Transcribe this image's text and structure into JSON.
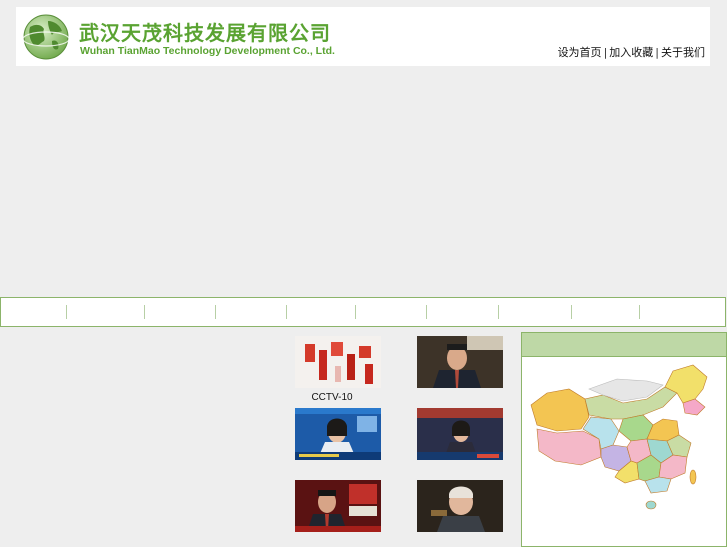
{
  "header": {
    "company_name_cn": "武汉天茂科技发展有限公司",
    "company_name_en": "Wuhan TianMao Technology Development Co., Ltd.",
    "links": {
      "set_homepage": "设为首页",
      "add_favorite": "加入收藏",
      "about_us": "关于我们",
      "separator": "|"
    }
  },
  "videos": {
    "items": [
      {
        "caption": "CCTV-10"
      },
      {
        "caption": ""
      },
      {
        "caption": ""
      },
      {
        "caption": ""
      },
      {
        "caption": ""
      },
      {
        "caption": ""
      }
    ]
  },
  "colors": {
    "brand_green": "#5aa332",
    "nav_border": "#8cb46a",
    "map_header": "#bed8a6",
    "page_bg": "#eeeeee"
  },
  "icons": {
    "logo": "globe-logo-icon",
    "map": "china-map-image"
  }
}
